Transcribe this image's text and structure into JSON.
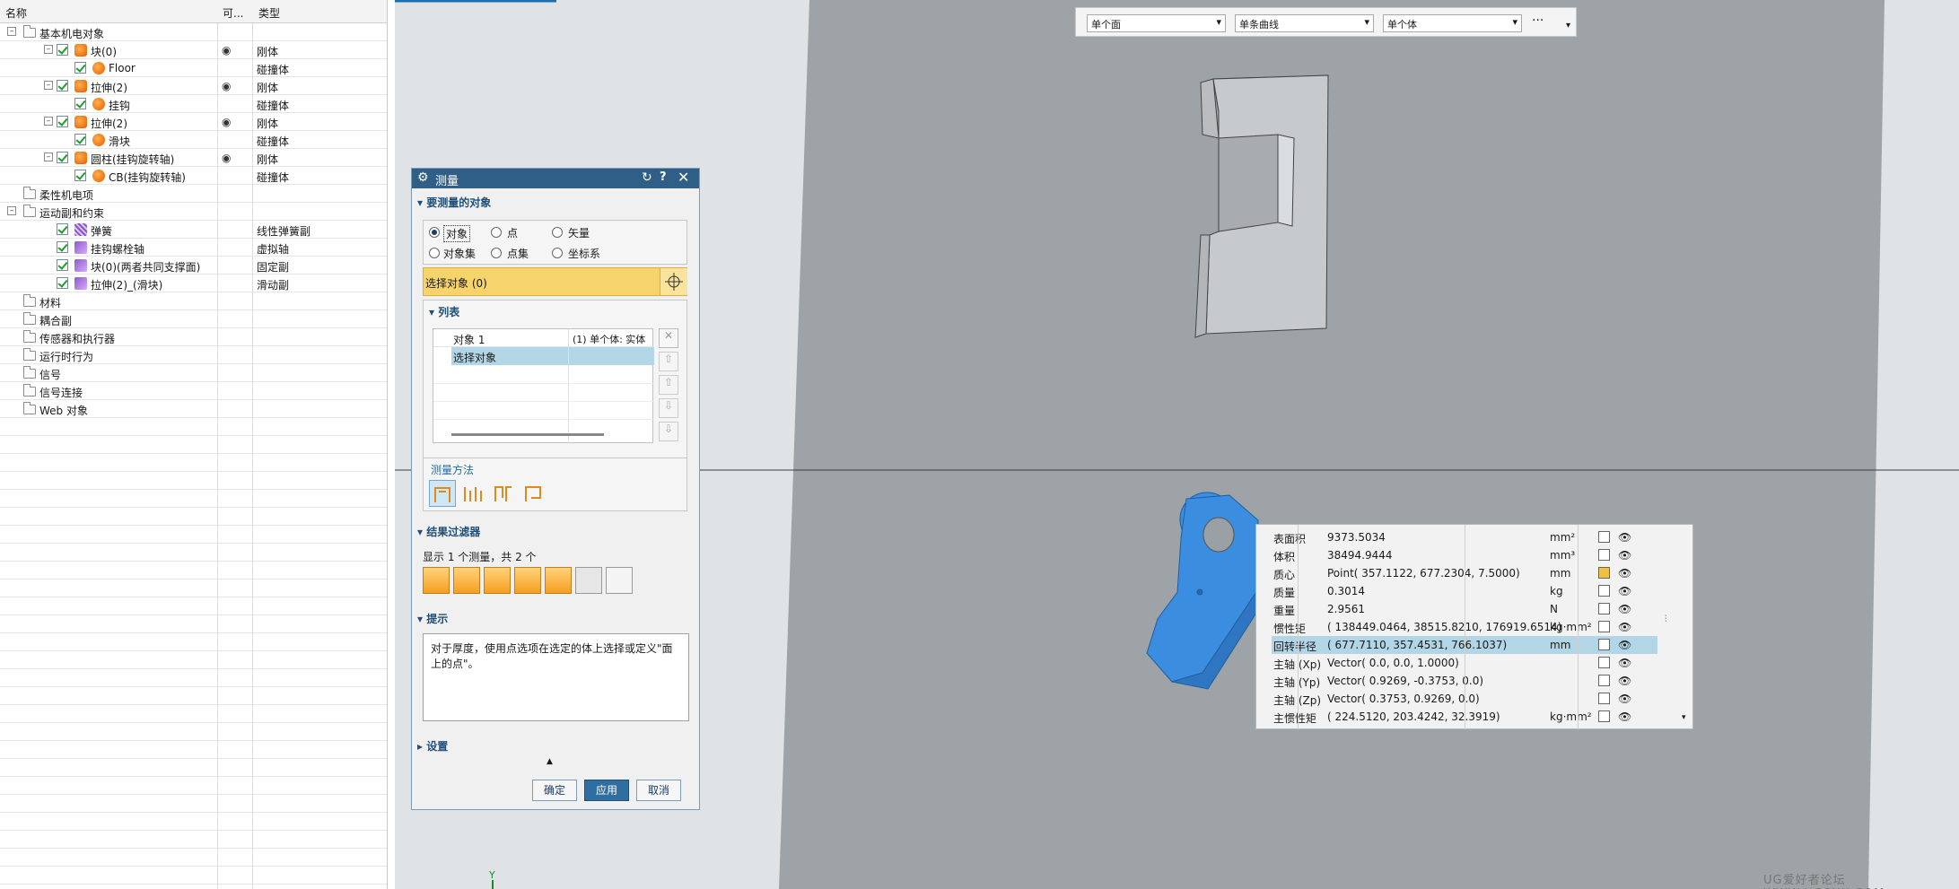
{
  "tree": {
    "headers": [
      "名称",
      "可...",
      "类型"
    ],
    "rows": [
      {
        "label": "基本机电对象",
        "type": "",
        "eye": false,
        "level": 0,
        "expand": "–",
        "check": false,
        "icon": "folder"
      },
      {
        "label": "块(0)",
        "type": "刚体",
        "eye": true,
        "level": 1,
        "expand": "–",
        "check": true,
        "icon": "body"
      },
      {
        "label": "Floor",
        "type": "碰撞体",
        "eye": false,
        "level": 2,
        "expand": "",
        "check": true,
        "icon": "coll"
      },
      {
        "label": "拉伸(2)",
        "type": "刚体",
        "eye": true,
        "level": 1,
        "expand": "–",
        "check": true,
        "icon": "body"
      },
      {
        "label": "挂钩",
        "type": "碰撞体",
        "eye": false,
        "level": 2,
        "expand": "",
        "check": true,
        "icon": "coll"
      },
      {
        "label": "拉伸(2)",
        "type": "刚体",
        "eye": true,
        "level": 1,
        "expand": "–",
        "check": true,
        "icon": "body"
      },
      {
        "label": "滑块",
        "type": "碰撞体",
        "eye": false,
        "level": 2,
        "expand": "",
        "check": true,
        "icon": "coll"
      },
      {
        "label": "圆柱(挂钩旋转轴)",
        "type": "刚体",
        "eye": true,
        "level": 1,
        "expand": "–",
        "check": true,
        "icon": "body"
      },
      {
        "label": "CB(挂钩旋转轴)",
        "type": "碰撞体",
        "eye": false,
        "level": 2,
        "expand": "",
        "check": true,
        "icon": "coll"
      },
      {
        "label": "柔性机电项",
        "type": "",
        "eye": false,
        "level": 0,
        "expand": "",
        "check": false,
        "icon": "folder"
      },
      {
        "label": "运动副和约束",
        "type": "",
        "eye": false,
        "level": 0,
        "expand": "–",
        "check": false,
        "icon": "folder"
      },
      {
        "label": "弹簧",
        "type": "线性弹簧副",
        "eye": false,
        "level": 1,
        "expand": "",
        "check": true,
        "icon": "spring"
      },
      {
        "label": "挂钩螺栓轴",
        "type": "虚拟轴",
        "eye": false,
        "level": 1,
        "expand": "",
        "check": true,
        "icon": "joint"
      },
      {
        "label": "块(0)(两者共同支撑面)",
        "type": "固定副",
        "eye": false,
        "level": 1,
        "expand": "",
        "check": true,
        "icon": "joint"
      },
      {
        "label": "拉伸(2)_(滑块)",
        "type": "滑动副",
        "eye": false,
        "level": 1,
        "expand": "",
        "check": true,
        "icon": "joint"
      },
      {
        "label": "材料",
        "type": "",
        "eye": false,
        "level": 0,
        "expand": "",
        "check": false,
        "icon": "folder"
      },
      {
        "label": "耦合副",
        "type": "",
        "eye": false,
        "level": 0,
        "expand": "",
        "check": false,
        "icon": "folder"
      },
      {
        "label": "传感器和执行器",
        "type": "",
        "eye": false,
        "level": 0,
        "expand": "",
        "check": false,
        "icon": "folder"
      },
      {
        "label": "运行时行为",
        "type": "",
        "eye": false,
        "level": 0,
        "expand": "",
        "check": false,
        "icon": "folder"
      },
      {
        "label": "信号",
        "type": "",
        "eye": false,
        "level": 0,
        "expand": "",
        "check": false,
        "icon": "folder"
      },
      {
        "label": "信号连接",
        "type": "",
        "eye": false,
        "level": 0,
        "expand": "",
        "check": false,
        "icon": "folder"
      },
      {
        "label": "Web 对象",
        "type": "",
        "eye": false,
        "level": 0,
        "expand": "",
        "check": false,
        "icon": "folder"
      }
    ]
  },
  "selection_toolbar": {
    "face_filter": "单个面",
    "curve_filter": "单条曲线",
    "body_filter": "单个体",
    "more": "···"
  },
  "dialog": {
    "title": "测量",
    "sections": {
      "objects": "要测量的对象",
      "list": "列表",
      "method": "测量方法",
      "filter": "结果过滤器",
      "hint": "提示",
      "settings": "设置"
    },
    "object_types": [
      "对象",
      "点",
      "矢量",
      "对象集",
      "点集",
      "坐标系"
    ],
    "select_prompt": "选择对象 (0)",
    "list_rows": [
      {
        "name": "对象 1",
        "value": "(1) 单个体: 实体"
      },
      {
        "name": "选择对象",
        "value": ""
      }
    ],
    "filter_text": "显示 1 个测量，共 2 个",
    "hint_text": "对于厚度，使用点选项在选定的体上选择或定义\"面上的点\"。",
    "buttons": {
      "ok": "确定",
      "apply": "应用",
      "cancel": "取消"
    }
  },
  "results": [
    {
      "name": "表面积",
      "value": "9373.5034",
      "unit": "mm²"
    },
    {
      "name": "体积",
      "value": "38494.9444",
      "unit": "mm³"
    },
    {
      "name": "质心",
      "value": "Point( 357.1122, 677.2304, 7.5000)",
      "unit": "mm"
    },
    {
      "name": "质量",
      "value": "0.3014",
      "unit": "kg"
    },
    {
      "name": "重量",
      "value": "2.9561",
      "unit": "N"
    },
    {
      "name": "惯性矩",
      "value": "( 138449.0464, 38515.8210, 176919.6514)",
      "unit": "kg·mm²"
    },
    {
      "name": "回转半径",
      "value": "( 677.7110, 357.4531, 766.1037)",
      "unit": "mm"
    },
    {
      "name": "主轴 (Xp)",
      "value": "Vector( 0.0, 0.0, 1.0000)",
      "unit": ""
    },
    {
      "name": "主轴 (Yp)",
      "value": "Vector( 0.9269, -0.3753, 0.0)",
      "unit": ""
    },
    {
      "name": "主轴 (Zp)",
      "value": "Vector( 0.3753, 0.9269, 0.0)",
      "unit": ""
    },
    {
      "name": "主惯性矩",
      "value": "( 224.5120, 203.4242, 32.3919)",
      "unit": "kg·mm²"
    }
  ],
  "axis_label": "Y",
  "watermark": "UG爱好者论坛 WWW.UGSNX.COM",
  "colors": {
    "viewport": "#a8aeb1",
    "part": "#3a8fe3",
    "dialog_title": "#2f5f86",
    "highlight": "#f7d36b"
  }
}
